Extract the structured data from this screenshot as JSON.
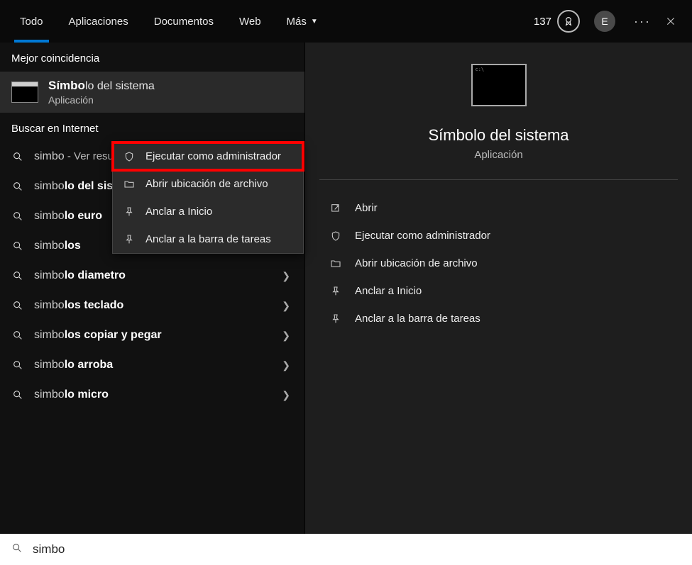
{
  "tabs": {
    "all": "Todo",
    "apps": "Aplicaciones",
    "docs": "Documentos",
    "web": "Web",
    "more": "Más"
  },
  "header": {
    "points": "137",
    "avatar_letter": "E"
  },
  "left": {
    "best_match_header": "Mejor coincidencia",
    "best_match": {
      "title_bold": "Símbo",
      "title_rest": "lo del sistema",
      "subtitle": "Aplicación"
    },
    "internet_header": "Buscar en Internet",
    "search_items": [
      {
        "typed": "simbo",
        "match": "",
        "suffix": " - Ver resultados web"
      },
      {
        "typed": "simbo",
        "match": "lo del sistema",
        "suffix": ""
      },
      {
        "typed": "simbo",
        "match": "lo euro",
        "suffix": ""
      },
      {
        "typed": "simbo",
        "match": "los",
        "suffix": ""
      },
      {
        "typed": "simbo",
        "match": "lo diametro",
        "suffix": ""
      },
      {
        "typed": "simbo",
        "match": "los teclado",
        "suffix": ""
      },
      {
        "typed": "simbo",
        "match": "los copiar y pegar",
        "suffix": ""
      },
      {
        "typed": "simbo",
        "match": "lo arroba",
        "suffix": ""
      },
      {
        "typed": "simbo",
        "match": "lo micro",
        "suffix": ""
      }
    ]
  },
  "context_menu": {
    "run_admin": "Ejecutar como administrador",
    "open_location": "Abrir ubicación de archivo",
    "pin_start": "Anclar a Inicio",
    "pin_taskbar": "Anclar a la barra de tareas"
  },
  "right": {
    "title": "Símbolo del sistema",
    "subtitle": "Aplicación",
    "actions": {
      "open": "Abrir",
      "run_admin": "Ejecutar como administrador",
      "open_location": "Abrir ubicación de archivo",
      "pin_start": "Anclar a Inicio",
      "pin_taskbar": "Anclar a la barra de tareas"
    }
  },
  "search": {
    "value": "simbo"
  }
}
